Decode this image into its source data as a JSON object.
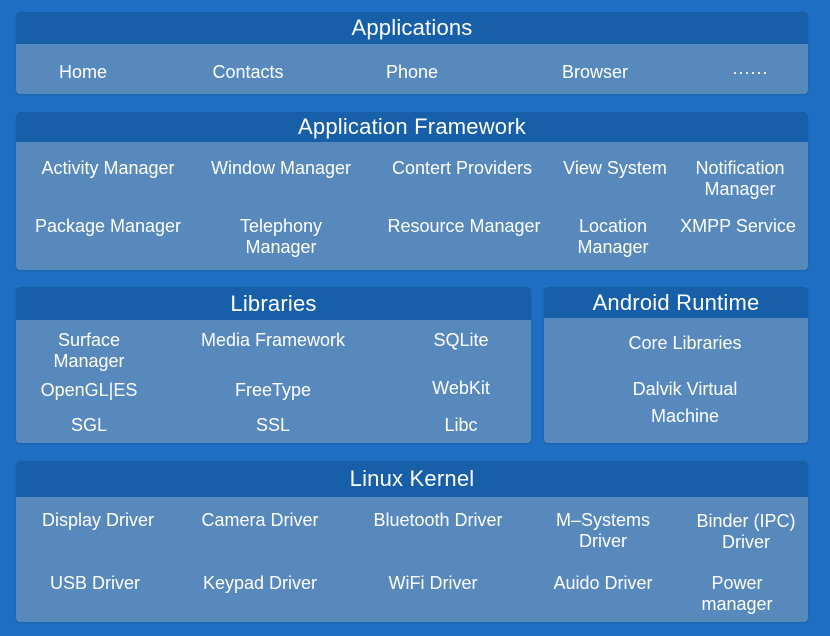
{
  "applications": {
    "title": "Applications",
    "items": [
      "Home",
      "Contacts",
      "Phone",
      "Browser",
      "······"
    ]
  },
  "framework": {
    "title": "Application Framework",
    "items": [
      "Activity Manager",
      "Window Manager",
      "Contert Providers",
      "View System",
      "Notification\nManager",
      "Package Manager",
      "Telephony\nManager",
      "Resource Manager",
      "Location\nManager",
      "XMPP Service"
    ]
  },
  "libraries": {
    "title": "Libraries",
    "items": [
      "Surface\nManager",
      "Media Framework",
      "SQLite",
      "OpenGL|ES",
      "FreeType",
      "WebKit",
      "SGL",
      "SSL",
      "Libc"
    ]
  },
  "runtime": {
    "title": "Android Runtime",
    "items": [
      "Core Libraries",
      "Dalvik Virtual\nMachine"
    ]
  },
  "kernel": {
    "title": "Linux Kernel",
    "items": [
      "Display Driver",
      "Camera Driver",
      "Bluetooth Driver",
      "M–Systems\nDriver",
      "Binder (IPC)\nDriver",
      "USB Driver",
      "Keypad Driver",
      "WiFi Driver",
      "Auido Driver",
      "Power\nmanager"
    ]
  }
}
